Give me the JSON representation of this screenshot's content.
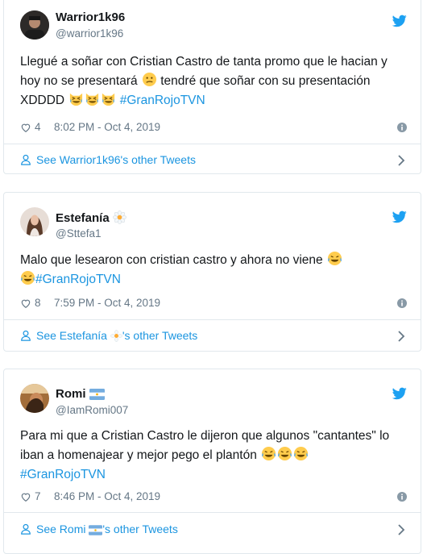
{
  "colors": {
    "link": "#1b95e0",
    "muted": "#657786",
    "border": "#e1e8ed",
    "twitter_blue": "#1da1f2"
  },
  "tweets": [
    {
      "name": "Warrior1k96",
      "handle": "@warrior1k96",
      "avatar_icon": "user-photo-avatar",
      "text_a": "Llegué a soñar con Cristian Castro de tanta promo que le hacian y hoy no se presentará",
      "text_b": " tendré que soñar con su presentación XDDDD",
      "hashtag": "#GranRojoTVN",
      "likes": "4",
      "time": "8:02 PM - Oct 4, 2019",
      "more_prefix": "See Warrior1k96's other Tweets",
      "more_suffix": ""
    },
    {
      "name": "Estefanía",
      "handle": "@Sttefa1",
      "avatar_icon": "user-photo-avatar",
      "text_a": "Malo que lesearon con cristian castro y ahora no viene",
      "text_b": "",
      "hashtag": "#GranRojoTVN",
      "likes": "8",
      "time": "7:59 PM - Oct 4, 2019",
      "more_prefix": "See Estefanía ",
      "more_suffix": "'s other Tweets"
    },
    {
      "name": "Romi",
      "handle": "@IamRomi007",
      "avatar_icon": "user-photo-avatar",
      "text_a": "Para mi que a Cristian Castro le dijeron que algunos \"cantantes\" lo iban a homenajear y mejor pego el plantón",
      "text_b": "",
      "hashtag": "#GranRojoTVN",
      "likes": "7",
      "time": "8:46 PM - Oct 4, 2019",
      "more_prefix": "See Romi ",
      "more_suffix": "'s other Tweets"
    }
  ]
}
